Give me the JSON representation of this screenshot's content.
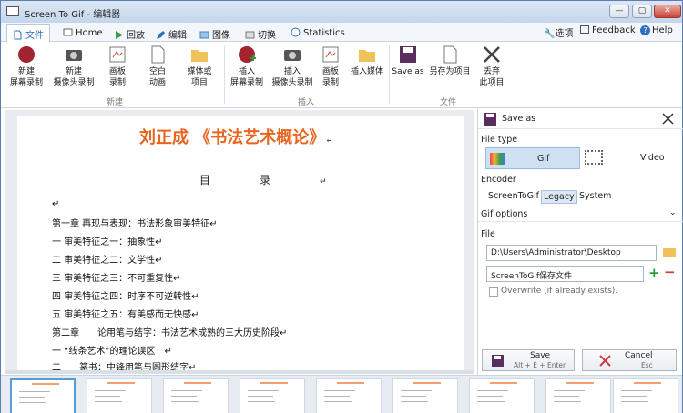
{
  "window": {
    "title": "Screen To Gif - 编辑器",
    "min": "—",
    "max": "▢",
    "close": "✕"
  },
  "tabs": [
    {
      "label": "文件"
    },
    {
      "label": "Home"
    },
    {
      "label": "回放"
    },
    {
      "label": "编辑"
    },
    {
      "label": "图像"
    },
    {
      "label": "切换"
    },
    {
      "label": "Statistics"
    }
  ],
  "topright": {
    "options": "选项",
    "feedback": "Feedback",
    "help": "Help"
  },
  "ribbon": {
    "new_group": {
      "buttons": [
        "新建\n屏幕录制",
        "新建\n摄像头录制",
        "画板\n录制",
        "空白\n动画",
        "媒体或\n项目"
      ],
      "label": "新建"
    },
    "insert_group": {
      "buttons": [
        "插入\n屏幕录制",
        "插入\n摄像头录制",
        "画板\n录制",
        "插入媒体"
      ],
      "label": "插入"
    },
    "file_group": {
      "buttons": [
        "Save as",
        "另存为项目",
        "丢弃\n此项目"
      ],
      "label": "文件"
    }
  },
  "document": {
    "title": "刘正成 《书法艺术概论》",
    "title_mark": "↵",
    "toc": "目录",
    "toc_mark": "↵",
    "blank_mark": "↵",
    "lines": [
      "第一章 再现与表现：书法形象审美特征↵",
      "一 审美特征之一：抽象性↵",
      "二 审美特征之二：文学性↵",
      "三 审美特征之三：不可重复性↵",
      "四 审美特征之四：时序不可逆转性↵",
      "五 审美特征之五：有美感而无快感↵",
      "第二章　　论用笔与结字：书法艺术成熟的三大历史阶段↵",
      "一 “线条艺术”的理论误区　↵",
      "二　　篆书：中锋用笔与圆形结字↵"
    ]
  },
  "panel": {
    "title": "Save as",
    "file_type_label": "File type",
    "gif": "Gif",
    "video": "Video",
    "encoder_label": "Encoder",
    "encoders": [
      "ScreenToGif",
      "Legacy",
      "System"
    ],
    "gif_options": "Gif options",
    "file_label": "File",
    "path": "D:\\Users\\Administrator\\Desktop",
    "filename": "ScreenToGif保存文件",
    "overwrite": "Overwrite (if already exists).",
    "save": "Save",
    "save_shortcut": "Alt + E + Enter",
    "cancel": "Cancel",
    "cancel_shortcut": "Esc"
  },
  "colors": {
    "accent": "#e8641e",
    "selection": "#5b9bd5",
    "tab_active": "#2e6fbd"
  }
}
